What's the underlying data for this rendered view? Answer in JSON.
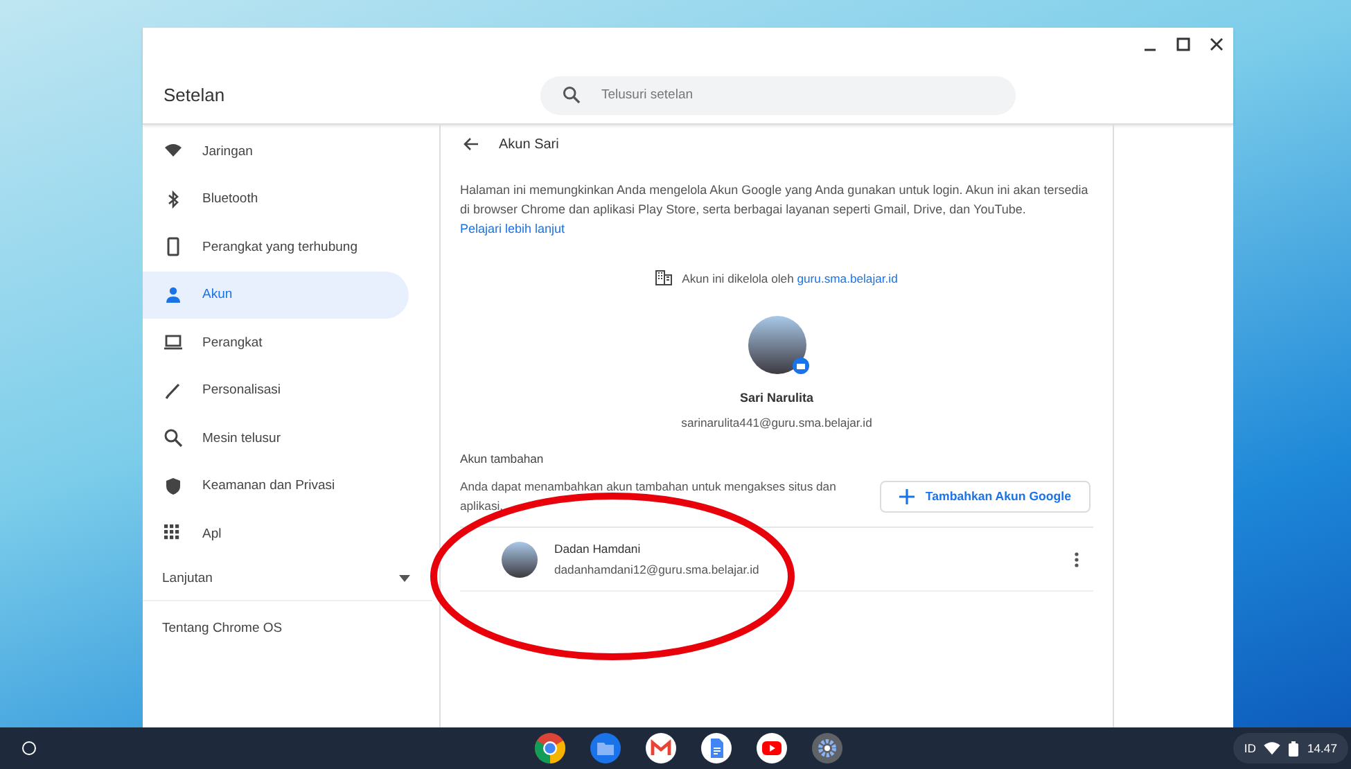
{
  "window": {
    "title": "Setelan",
    "search": {
      "placeholder": "Telusuri setelan"
    }
  },
  "sidebar": {
    "items": [
      {
        "label": "Jaringan",
        "selected": false
      },
      {
        "label": "Bluetooth",
        "selected": false
      },
      {
        "label": "Perangkat yang terhubung",
        "selected": false
      },
      {
        "label": "Akun",
        "selected": true
      },
      {
        "label": "Perangkat",
        "selected": false
      },
      {
        "label": "Personalisasi",
        "selected": false
      },
      {
        "label": "Mesin telusur",
        "selected": false
      },
      {
        "label": "Keamanan dan Privasi",
        "selected": false
      },
      {
        "label": "Apl",
        "selected": false
      }
    ],
    "advanced": {
      "label": "Lanjutan",
      "expanded": false
    },
    "about": "Tentang Chrome OS"
  },
  "page": {
    "title": "Akun Sari",
    "description": "Halaman ini memungkinkan Anda mengelola Akun Google yang Anda gunakan untuk login. Akun ini akan tersedia di browser Chrome dan aplikasi Play Store, serta berbagai layanan seperti Gmail, Drive, dan YouTube.",
    "learn_more": "Pelajari lebih lanjut",
    "managed_text": "Akun ini dikelola oleh",
    "managed_domain": "guru.sma.belajar.id",
    "primary": {
      "name": "Sari Narulita",
      "email": "sarinarulita441@guru.sma.belajar.id"
    },
    "additional": {
      "heading": "Akun tambahan",
      "description": "Anda dapat menambahkan akun tambahan untuk mengakses situs dan aplikasi.",
      "add_button": "Tambahkan Akun Google",
      "accounts": [
        {
          "name": "Dadan Hamdani",
          "email": "dadanhamdani12@guru.sma.belajar.id"
        }
      ]
    }
  },
  "shelf": {
    "status": {
      "language": "ID",
      "time": "14.47"
    }
  }
}
